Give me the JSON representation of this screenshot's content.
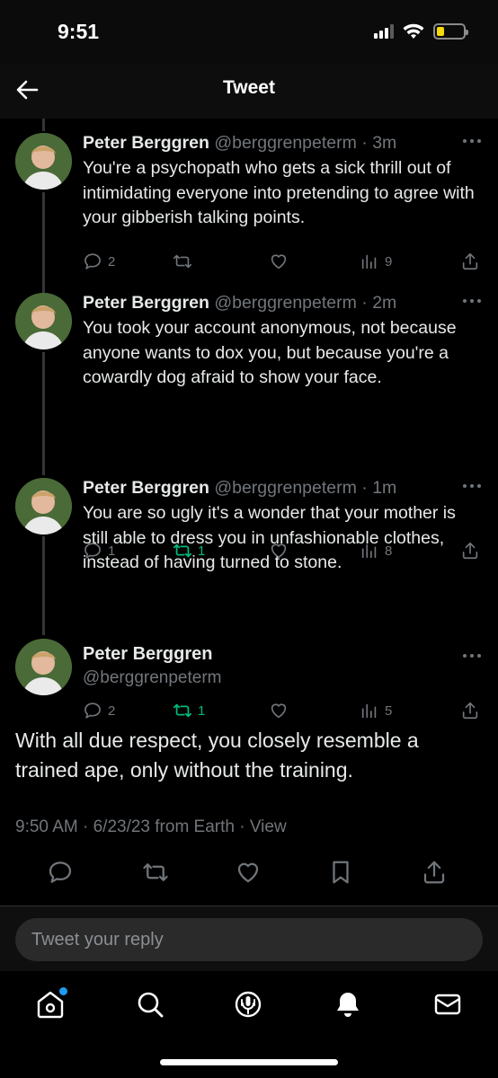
{
  "status_bar": {
    "time": "9:51"
  },
  "header": {
    "title": "Tweet"
  },
  "replies": [
    {
      "name": "Peter Berggren",
      "handle": "@berggrenpeterm",
      "time": "3m",
      "text": "You're a psychopath who gets a sick thrill out of intimidating everyone into pretending to agree with your gibberish talking points.",
      "replies": "2",
      "retweets": "",
      "likes": "",
      "views": "9",
      "retweeted": false
    },
    {
      "name": "Peter Berggren",
      "handle": "@berggrenpeterm",
      "time": "2m",
      "text": "You took your account anonymous, not because anyone wants to dox you, but because you're a cowardly dog afraid to show your face.",
      "replies": "1",
      "retweets": "1",
      "likes": "",
      "views": "8",
      "retweeted": true
    },
    {
      "name": "Peter Berggren",
      "handle": "@berggrenpeterm",
      "time": "1m",
      "text": "You are so ugly it's a wonder that your mother is still able to dress you in unfashionable clothes, instead of having turned to stone.",
      "replies": "2",
      "retweets": "1",
      "likes": "",
      "views": "5",
      "retweeted": true
    }
  ],
  "main_tweet": {
    "name": "Peter Berggren",
    "handle": "@berggrenpeterm",
    "text": "With all due respect, you closely resemble a trained ape, only without the training.",
    "timestamp": "9:50 AM · 6/23/23 from Earth · ",
    "view_label": "View"
  },
  "reply_box": {
    "placeholder": "Tweet your reply"
  },
  "nav": {
    "home_has_notification": true
  },
  "colors": {
    "accent": "#1d9bf0",
    "retweet_green": "#00ba7c",
    "muted": "#71767b"
  }
}
